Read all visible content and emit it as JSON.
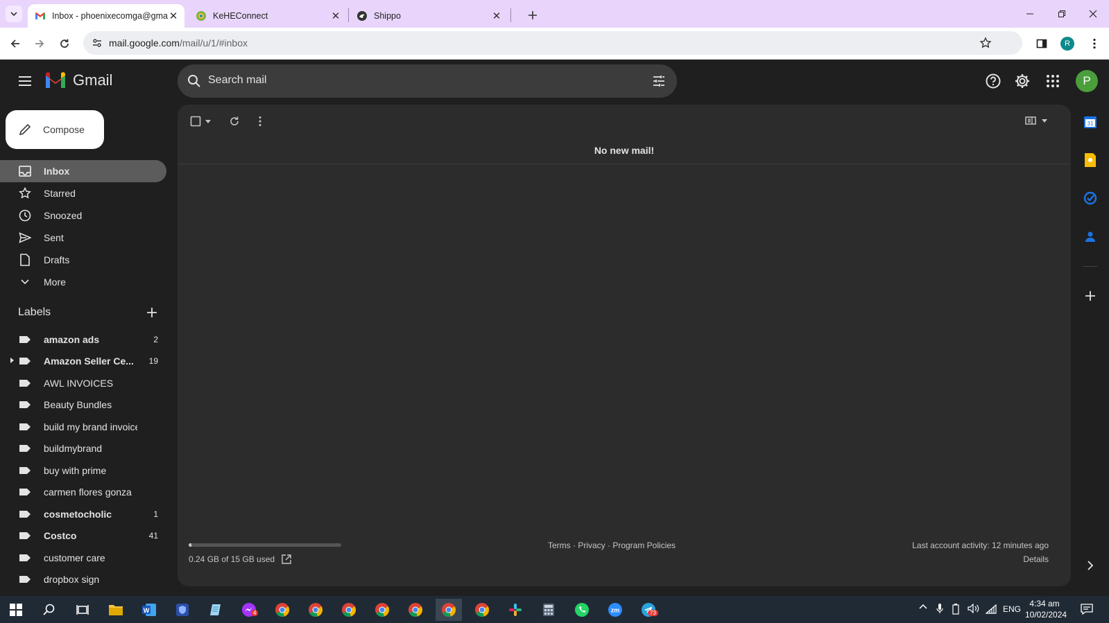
{
  "browser": {
    "tabs": [
      {
        "title": "Inbox - phoenixecomga@gmail.com",
        "favicon": "gmail-icon",
        "active": true
      },
      {
        "title": "KeHEConnect",
        "favicon": "kehe-icon",
        "active": false
      },
      {
        "title": "Shippo",
        "favicon": "shippo-icon",
        "active": false
      }
    ],
    "url_host": "mail.google.com",
    "url_path": "/mail/u/1/#inbox",
    "profile_initial": "R"
  },
  "gmail": {
    "app_name": "Gmail",
    "search_placeholder": "Search mail",
    "compose_label": "Compose",
    "avatar_initial": "P",
    "nav": [
      {
        "label": "Inbox",
        "icon": "inbox-icon",
        "selected": true
      },
      {
        "label": "Starred",
        "icon": "star-icon"
      },
      {
        "label": "Snoozed",
        "icon": "clock-icon"
      },
      {
        "label": "Sent",
        "icon": "send-icon"
      },
      {
        "label": "Drafts",
        "icon": "draft-icon"
      },
      {
        "label": "More",
        "icon": "chevron-down-icon"
      }
    ],
    "labels_heading": "Labels",
    "labels": [
      {
        "name": "amazon ads",
        "count": "2",
        "bold": true
      },
      {
        "name": "Amazon Seller Ce...",
        "count": "19",
        "bold": true,
        "expandable": true
      },
      {
        "name": "AWL INVOICES",
        "count": "",
        "bold": false
      },
      {
        "name": "Beauty Bundles",
        "count": "",
        "bold": false
      },
      {
        "name": "build my brand invoice",
        "count": "",
        "bold": false
      },
      {
        "name": "buildmybrand",
        "count": "",
        "bold": false
      },
      {
        "name": "buy with prime",
        "count": "",
        "bold": false
      },
      {
        "name": "carmen flores gonza",
        "count": "",
        "bold": false
      },
      {
        "name": "cosmetocholic",
        "count": "1",
        "bold": true
      },
      {
        "name": "Costco",
        "count": "41",
        "bold": true
      },
      {
        "name": "customer care",
        "count": "",
        "bold": false
      },
      {
        "name": "dropbox sign",
        "count": "",
        "bold": false
      }
    ],
    "empty_message": "No new mail!",
    "footer": {
      "storage_text": "0.24 GB of 15 GB used",
      "storage_fraction": 0.016,
      "links": "Terms · Privacy · Program Policies",
      "activity": "Last account activity: 12 minutes ago",
      "details": "Details"
    }
  },
  "taskbar": {
    "language": "ENG",
    "time": "4:34 am",
    "date": "10/02/2024",
    "badges": {
      "app4": "4",
      "telegram": "73"
    }
  },
  "colors": {
    "tabbar": "#e9d5fb",
    "gmail_bg": "#1f1f1f",
    "panel_bg": "#2c2c2c",
    "avatar_green": "#4a9e3b",
    "profile_teal": "#0f8a8c",
    "taskbar": "#202a35"
  }
}
